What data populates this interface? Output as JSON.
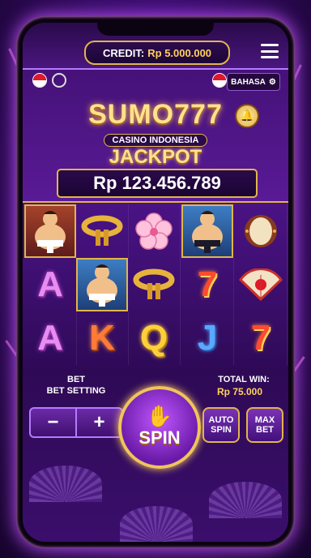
{
  "header": {
    "credit_label": "CREDIT:",
    "credit_value": "Rp 5.000.000",
    "language_button": "BAHASA"
  },
  "logo": {
    "title": "SUMO777",
    "subtitle": "CASINO INDONESIA"
  },
  "jackpot": {
    "label": "JACKPOT",
    "amount": "Rp 123.456.789"
  },
  "reels": {
    "rows": [
      [
        "sumo-wrestler",
        "rope-belt",
        "sakura-flower",
        "sumo-wrestler",
        "taiko-drum"
      ],
      [
        "A",
        "sumo-wrestler",
        "rope-belt",
        "7",
        "folding-fan"
      ],
      [
        "A",
        "K",
        "Q",
        "J",
        "7"
      ]
    ],
    "letters": {
      "r1c0": "A",
      "r1c3": "7",
      "r2c0": "A",
      "r2c1": "K",
      "r2c2": "Q",
      "r2c3": "J",
      "r2c4": "7"
    }
  },
  "controls": {
    "bet_label": "BET",
    "bet_setting_label": "BET SETTING",
    "minus_label": "−",
    "plus_label": "+",
    "spin_label": "SPIN",
    "total_win_label": "TOTAL WIN:",
    "total_win_value": "Rp 75.000",
    "auto_spin_label": "AUTO SPIN",
    "max_bet_label": "MAX BET"
  },
  "colors": {
    "gold": "#e2b54a",
    "purple": "#5a1a96",
    "highlight_red": "#a5432a",
    "highlight_blue": "#3d7ec4"
  }
}
